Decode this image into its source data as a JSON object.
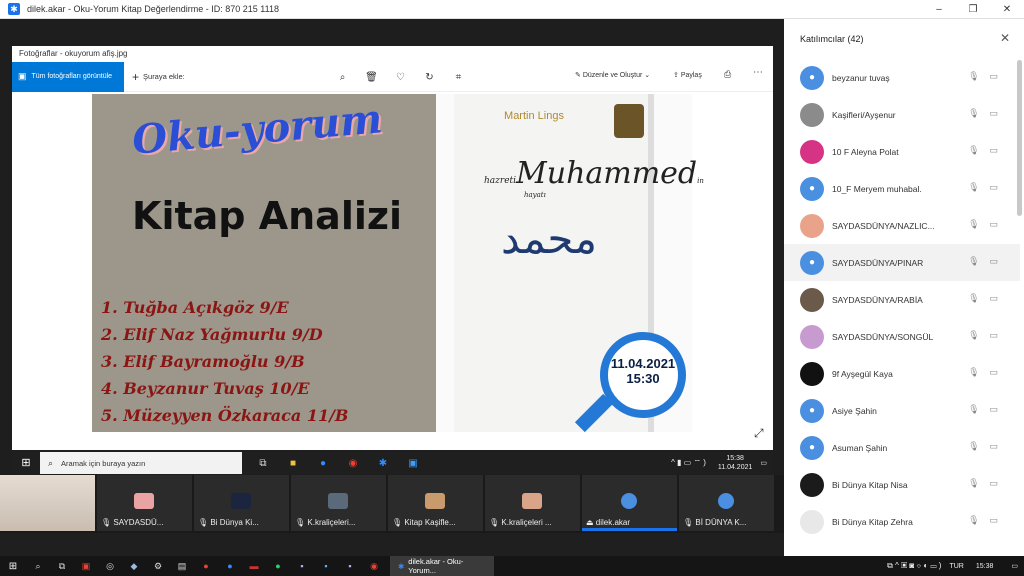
{
  "window": {
    "title": "dilek.akar - Oku-Yorum Kitap Değerlendirme - ID: 870 215 1118",
    "min": "–",
    "max": "❐",
    "close": "✕"
  },
  "photos": {
    "title": "Fotoğraflar - okuyorum afiş.jpg",
    "all_photos": "Tüm fotoğrafları görüntüle",
    "add_to": "Şuraya ekle:",
    "edit_create": "Düzenle ve Oluştur",
    "share": "Paylaş"
  },
  "poster": {
    "headline": "Oku-yorum",
    "subtitle": "Kitap Analizi",
    "names": [
      "1. Tuğba Açıkgöz 9/E",
      "2. Elif Naz Yağmurlu 9/D",
      "3. Elif Bayramoğlu 9/B",
      "4. Beyzanur Tuvaş 10/E",
      "5. Müzeyyen Özkaraca 11/B"
    ],
    "book_author": "Martin Lings",
    "book_title": "Muhammed",
    "book_title_prefix": "hazreti",
    "book_title_suffix": "in",
    "book_title_line2": "hayatı",
    "badge_date": "11.04.2021",
    "badge_time": "15:30"
  },
  "inner_taskbar": {
    "search_placeholder": "Aramak için buraya yazın",
    "time": "15:38",
    "date": "11.04.2021"
  },
  "thumbnails": [
    {
      "label": "SAYDASDÜ...",
      "color": "#e9a3a3"
    },
    {
      "label": "Bi Dünya Ki...",
      "color": "#1b2540"
    },
    {
      "label": "K.kraliçeleri...",
      "color": "#5a6a7a"
    },
    {
      "label": "Kitap Kaşifle...",
      "color": "#c99a6b"
    },
    {
      "label": "K.kraliçeleri ...",
      "color": "#d9a48a"
    },
    {
      "label": "dilek.akar",
      "color": "#4a8fe0"
    },
    {
      "label": "Bİ DÜNYA K...",
      "color": "#4a8fe0"
    }
  ],
  "taskbar": {
    "running_app": "dilek.akar - Oku-Yorum...",
    "lang": "TUR",
    "time": "15:38"
  },
  "participants": {
    "title": "Katılımcılar (42)",
    "list": [
      {
        "name": "beyzanur tuvaş",
        "avatar_color": "#4a8fe0"
      },
      {
        "name": "Kaşifleri/Ayşenur",
        "avatar_color": "#8b8b8b"
      },
      {
        "name": "10 F Aleyna Polat",
        "avatar_color": "#d63384"
      },
      {
        "name": "10_F Meryem muhabal.",
        "avatar_color": "#4a8fe0"
      },
      {
        "name": "SAYDASDÜNYA/NAZLIC...",
        "avatar_color": "#e9a38a"
      },
      {
        "name": "SAYDASDÜNYA/PINAR",
        "avatar_color": "#4a8fe0"
      },
      {
        "name": "SAYDASDÜNYA/RABİA",
        "avatar_color": "#6b5a4a"
      },
      {
        "name": "SAYDASDÜNYA/SONGÜL",
        "avatar_color": "#c79bd0"
      },
      {
        "name": "9f Ayşegül Kaya",
        "avatar_color": "#111111"
      },
      {
        "name": "Asiye Şahin",
        "avatar_color": "#4a8fe0"
      },
      {
        "name": "Asuman Şahin",
        "avatar_color": "#4a8fe0"
      },
      {
        "name": "Bi Dünya Kitap Nisa",
        "avatar_color": "#1b1b1b"
      },
      {
        "name": "Bi Dünya Kitap Zehra",
        "avatar_color": "#e8e8e8"
      }
    ]
  }
}
